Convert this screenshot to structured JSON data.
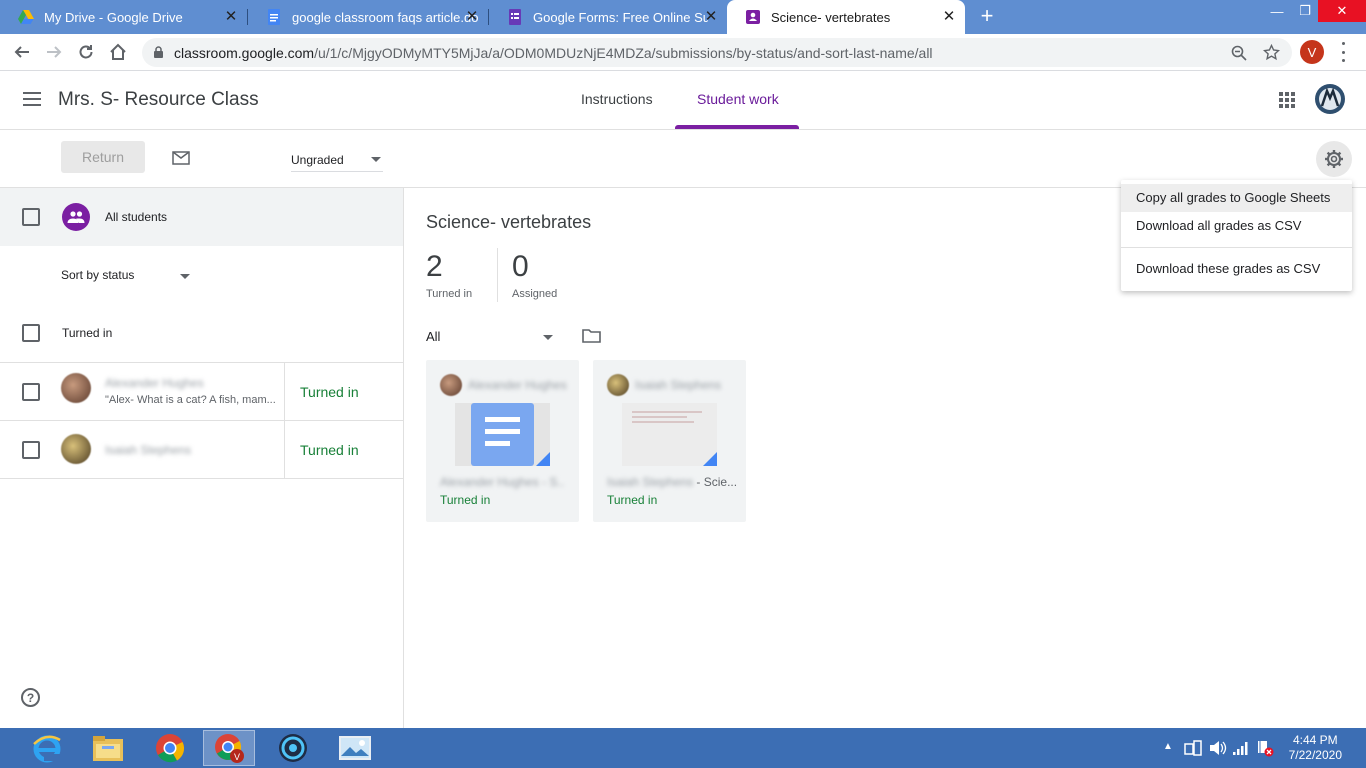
{
  "browser": {
    "tabs": [
      {
        "title": "My Drive - Google Drive",
        "icon": "google-drive-icon"
      },
      {
        "title": "google classroom faqs article.do",
        "icon": "google-docs-icon"
      },
      {
        "title": "Google Forms: Free Online Surve",
        "icon": "google-forms-icon"
      },
      {
        "title": "Science- vertebrates",
        "icon": "google-classroom-icon"
      }
    ],
    "url_main": "classroom.google.com",
    "url_path": "/u/1/c/MjgyODMyMTY5MjJa/a/ODM0MDUzNjE4MDZa/submissions/by-status/and-sort-last-name/all",
    "profile_initial": "V"
  },
  "classroom": {
    "class_title": "Mrs. S- Resource Class",
    "tab_instructions": "Instructions",
    "tab_student_work": "Student work",
    "return_label": "Return",
    "grade_filter": "Ungraded",
    "all_students": "All students",
    "sort_label": "Sort by status",
    "group_heading": "Turned in",
    "students": [
      {
        "name": "Alexander Hughes",
        "snippet": "\"Alex- What is a cat? A fish, mam...",
        "status": "Turned in"
      },
      {
        "name": "Isaiah Stephens",
        "snippet": "",
        "status": "Turned in"
      }
    ],
    "assignment_title": "Science- vertebrates",
    "turned_in_count": "2",
    "turned_in_label": "Turned in",
    "assigned_count": "0",
    "assigned_label": "Assigned",
    "filter_all": "All",
    "cards": [
      {
        "name": "Alexander Hughes",
        "file": "Alexander Hughes - S...",
        "status": "Turned in"
      },
      {
        "name": "Isaiah Stephens",
        "file_blur": "Isaiah Stephens",
        "file_suffix": " - Scie...",
        "status": "Turned in"
      }
    ],
    "menu": {
      "copy_sheets": "Copy all grades to Google Sheets",
      "download_all": "Download all grades as CSV",
      "download_these": "Download these grades as CSV"
    }
  },
  "taskbar": {
    "time": "4:44 PM",
    "date": "7/22/2020"
  },
  "colors": {
    "accent_purple": "#7b1fa2",
    "status_green": "#188038",
    "tab_strip": "#5f8ed1",
    "taskbar": "#3c6eb4"
  }
}
